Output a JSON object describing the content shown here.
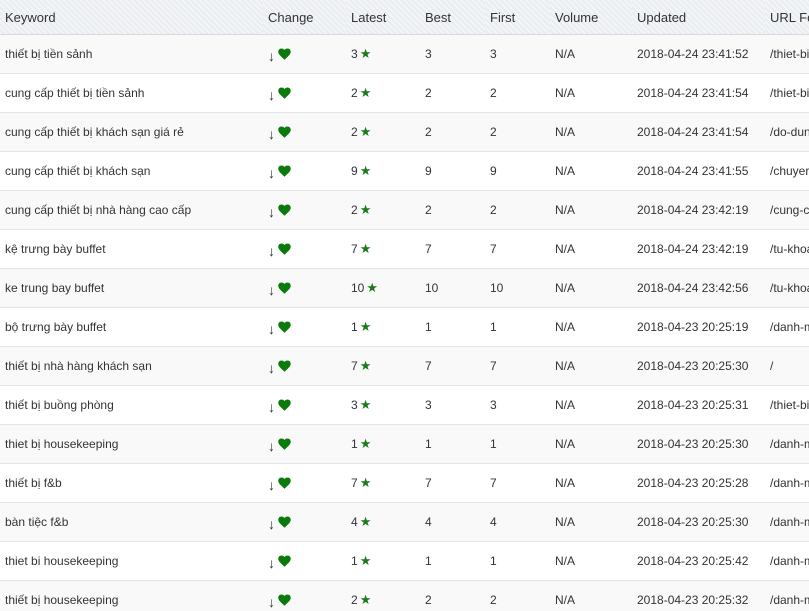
{
  "headers": [
    "Keyword",
    "Change",
    "Latest",
    "Best",
    "First",
    "Volume",
    "Updated",
    "URL Fo"
  ],
  "icons": {
    "change_arrow": "down-arrow-icon",
    "change_heart": "heart-icon",
    "latest_star": "star-icon"
  },
  "colors": {
    "heart": "#0a7a0a",
    "star": "#1a7a1a",
    "header_bg": "#e9ecf1"
  },
  "change_arrow_glyph": "↓",
  "star_glyph": "★",
  "rows": [
    {
      "keyword": "thiết bị tiền sảnh",
      "latest": "3",
      "best": "3",
      "first": "3",
      "volume": "N/A",
      "updated": "2018-04-24 23:41:52",
      "url": "/thiet-bi"
    },
    {
      "keyword": "cung cấp thiết bị tiền sảnh",
      "latest": "2",
      "best": "2",
      "first": "2",
      "volume": "N/A",
      "updated": "2018-04-24 23:41:54",
      "url": "/thiet-bi"
    },
    {
      "keyword": "cung cấp thiết bị khách sạn giá rẻ",
      "latest": "2",
      "best": "2",
      "first": "2",
      "volume": "N/A",
      "updated": "2018-04-24 23:41:54",
      "url": "/do-dun"
    },
    {
      "keyword": "cung cấp thiết bị khách sạn",
      "latest": "9",
      "best": "9",
      "first": "9",
      "volume": "N/A",
      "updated": "2018-04-24 23:41:55",
      "url": "/chuyer"
    },
    {
      "keyword": "cung cấp thiết bị nhà hàng cao cấp",
      "latest": "2",
      "best": "2",
      "first": "2",
      "volume": "N/A",
      "updated": "2018-04-24 23:42:19",
      "url": "/cung-c"
    },
    {
      "keyword": "kệ trưng bày buffet",
      "latest": "7",
      "best": "7",
      "first": "7",
      "volume": "N/A",
      "updated": "2018-04-24 23:42:19",
      "url": "/tu-khoa"
    },
    {
      "keyword": "ke trung bay buffet",
      "latest": "10",
      "best": "10",
      "first": "10",
      "volume": "N/A",
      "updated": "2018-04-24 23:42:56",
      "url": "/tu-khoa"
    },
    {
      "keyword": "bộ trưng bày buffet",
      "latest": "1",
      "best": "1",
      "first": "1",
      "volume": "N/A",
      "updated": "2018-04-23 20:25:19",
      "url": "/danh-m"
    },
    {
      "keyword": "thiết bị nhà hàng khách sạn",
      "latest": "7",
      "best": "7",
      "first": "7",
      "volume": "N/A",
      "updated": "2018-04-23 20:25:30",
      "url": "/"
    },
    {
      "keyword": "thiết bị buồng phòng",
      "latest": "3",
      "best": "3",
      "first": "3",
      "volume": "N/A",
      "updated": "2018-04-23 20:25:31",
      "url": "/thiet-bi"
    },
    {
      "keyword": "thiet bị housekeeping",
      "latest": "1",
      "best": "1",
      "first": "1",
      "volume": "N/A",
      "updated": "2018-04-23 20:25:30",
      "url": "/danh-m"
    },
    {
      "keyword": "thiết bị f&b",
      "latest": "7",
      "best": "7",
      "first": "7",
      "volume": "N/A",
      "updated": "2018-04-23 20:25:28",
      "url": "/danh-m"
    },
    {
      "keyword": "bàn tiệc f&b",
      "latest": "4",
      "best": "4",
      "first": "4",
      "volume": "N/A",
      "updated": "2018-04-23 20:25:30",
      "url": "/danh-m"
    },
    {
      "keyword": "thiet bi housekeeping",
      "latest": "1",
      "best": "1",
      "first": "1",
      "volume": "N/A",
      "updated": "2018-04-23 20:25:42",
      "url": "/danh-m"
    },
    {
      "keyword": "thiết bị housekeeping",
      "latest": "2",
      "best": "2",
      "first": "2",
      "volume": "N/A",
      "updated": "2018-04-23 20:25:32",
      "url": "/danh-m"
    }
  ]
}
